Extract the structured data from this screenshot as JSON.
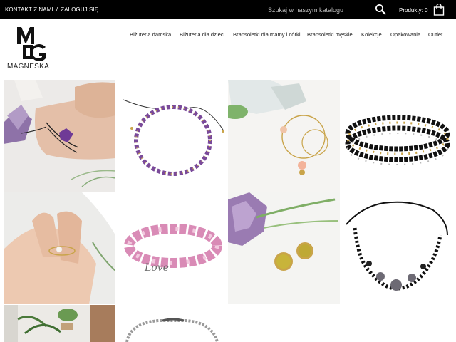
{
  "topbar": {
    "contact": "KONTAKT Z NAMI",
    "separator": "/",
    "login": "ZALOGUJ SIĘ",
    "search_placeholder": "Szukaj w naszym katalogu",
    "cart_label": "Produkty: 0"
  },
  "logo": {
    "brand": "MAGNESKA"
  },
  "nav": {
    "items": [
      "Biżuteria damska",
      "Biżuteria dla dzieci",
      "Bransoletki dla mamy i córki",
      "Bransoletki męskie",
      "Kolekcje",
      "Opakowania",
      "Outlet"
    ]
  },
  "products": {
    "bracelet_charm_text": "Love"
  },
  "colors": {
    "topbar": "#000000",
    "accent": "#000000"
  },
  "icons": [
    "search-icon",
    "cart-icon"
  ]
}
